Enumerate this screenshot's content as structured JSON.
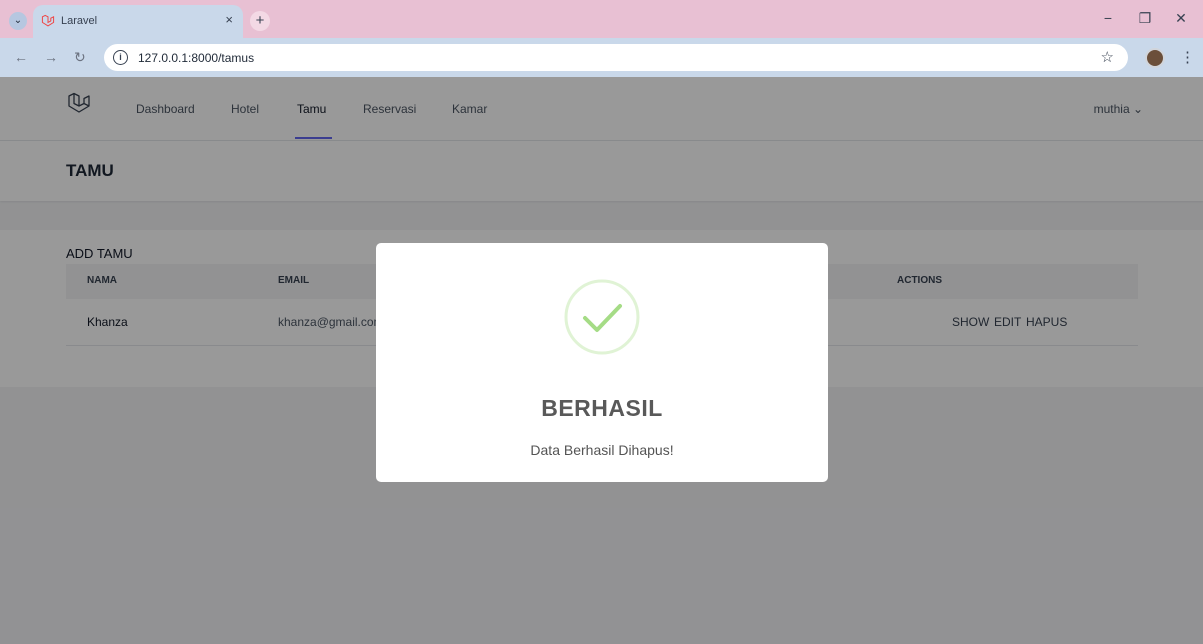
{
  "browser": {
    "tab_title": "Laravel",
    "tab_close": "×",
    "new_tab": "+",
    "url": "127.0.0.1:8000/tamus",
    "window_controls": {
      "minimize": "−",
      "maximize": "❐",
      "close": "✕"
    }
  },
  "navbar": {
    "links": [
      "Dashboard",
      "Hotel",
      "Tamu",
      "Reservasi",
      "Kamar"
    ],
    "active": "Tamu",
    "user": "muthia ⌄"
  },
  "page": {
    "title": "TAMU"
  },
  "table": {
    "add_label": "ADD TAMU",
    "headers": {
      "name": "NAMA",
      "email": "EMAIL",
      "actions": "ACTIONS"
    },
    "rows": [
      {
        "name": "Khanza",
        "email": "khanza@gmail.com",
        "show": "SHOW",
        "edit": "EDIT",
        "delete": "HAPUS"
      }
    ]
  },
  "modal": {
    "title": "BERHASIL",
    "text": "Data Berhasil Dihapus!",
    "icon": "success-check-icon"
  },
  "colors": {
    "tabbar": "#e8c0d3",
    "toolbar": "#c9d8ea",
    "accent": "#6366f1",
    "success": "#a5dc86",
    "laravel": "#ef4444"
  }
}
